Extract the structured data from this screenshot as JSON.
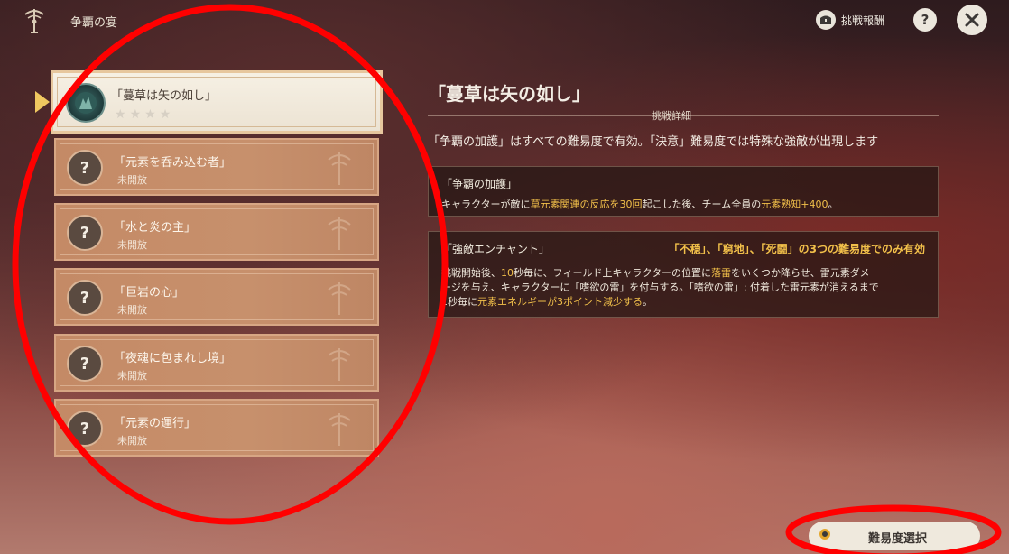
{
  "header": {
    "title": "争覇の宴",
    "reward_label": "挑戦報酬",
    "help_glyph": "?",
    "close_glyph": "✕"
  },
  "challenges": [
    {
      "name": "「蔓草は矢の如し」",
      "status": "",
      "stars": 4,
      "selected": true
    },
    {
      "name": "「元素を呑み込む者」",
      "status": "未開放",
      "badge": "?"
    },
    {
      "name": "「水と炎の主」",
      "status": "未開放",
      "badge": "?"
    },
    {
      "name": "「巨岩の心」",
      "status": "未開放",
      "badge": "?"
    },
    {
      "name": "「夜魂に包まれし境」",
      "status": "未開放",
      "badge": "?"
    },
    {
      "name": "「元素の運行」",
      "status": "未開放",
      "badge": "?"
    }
  ],
  "detail": {
    "title": "「蔓草は矢の如し」",
    "section_label": "挑戦詳細",
    "summary": "「争覇の加護」はすべての難易度で有効。「決意」難易度では特殊な強敵が出現します",
    "blessing": {
      "title": "「争覇の加護」",
      "body_prefix": "キャラクターが敵に",
      "body_hl1": "草元素関連の反応を30回",
      "body_mid": "起こした後、チーム全員の",
      "body_hl2": "元素熟知+400",
      "body_suffix": "。"
    },
    "enchant": {
      "title": "「強敵エンチャント」",
      "note": "「不穏」、「窮地」、「死闘」の3つの難易度でのみ有効",
      "l1a": "挑戦開始後、",
      "l1b": "10",
      "l1c": "秒毎に、フィールド上キャラクターの位置に",
      "l1d": "落雷",
      "l1e": "をいくつか降らせ、雷元素ダメ",
      "l2": "ージを与え、キャラクターに「嗜欲の雷」を付与する。「嗜欲の雷」: 付着した雷元素が消えるまで",
      "l3a": "1秒毎に",
      "l3b": "元素エネルギーが3ポイント減少する",
      "l3c": "。"
    }
  },
  "footer": {
    "difficulty_button": "難易度選択"
  },
  "colors": {
    "annotation": "#ff0000",
    "highlight": "#f2c04a"
  }
}
